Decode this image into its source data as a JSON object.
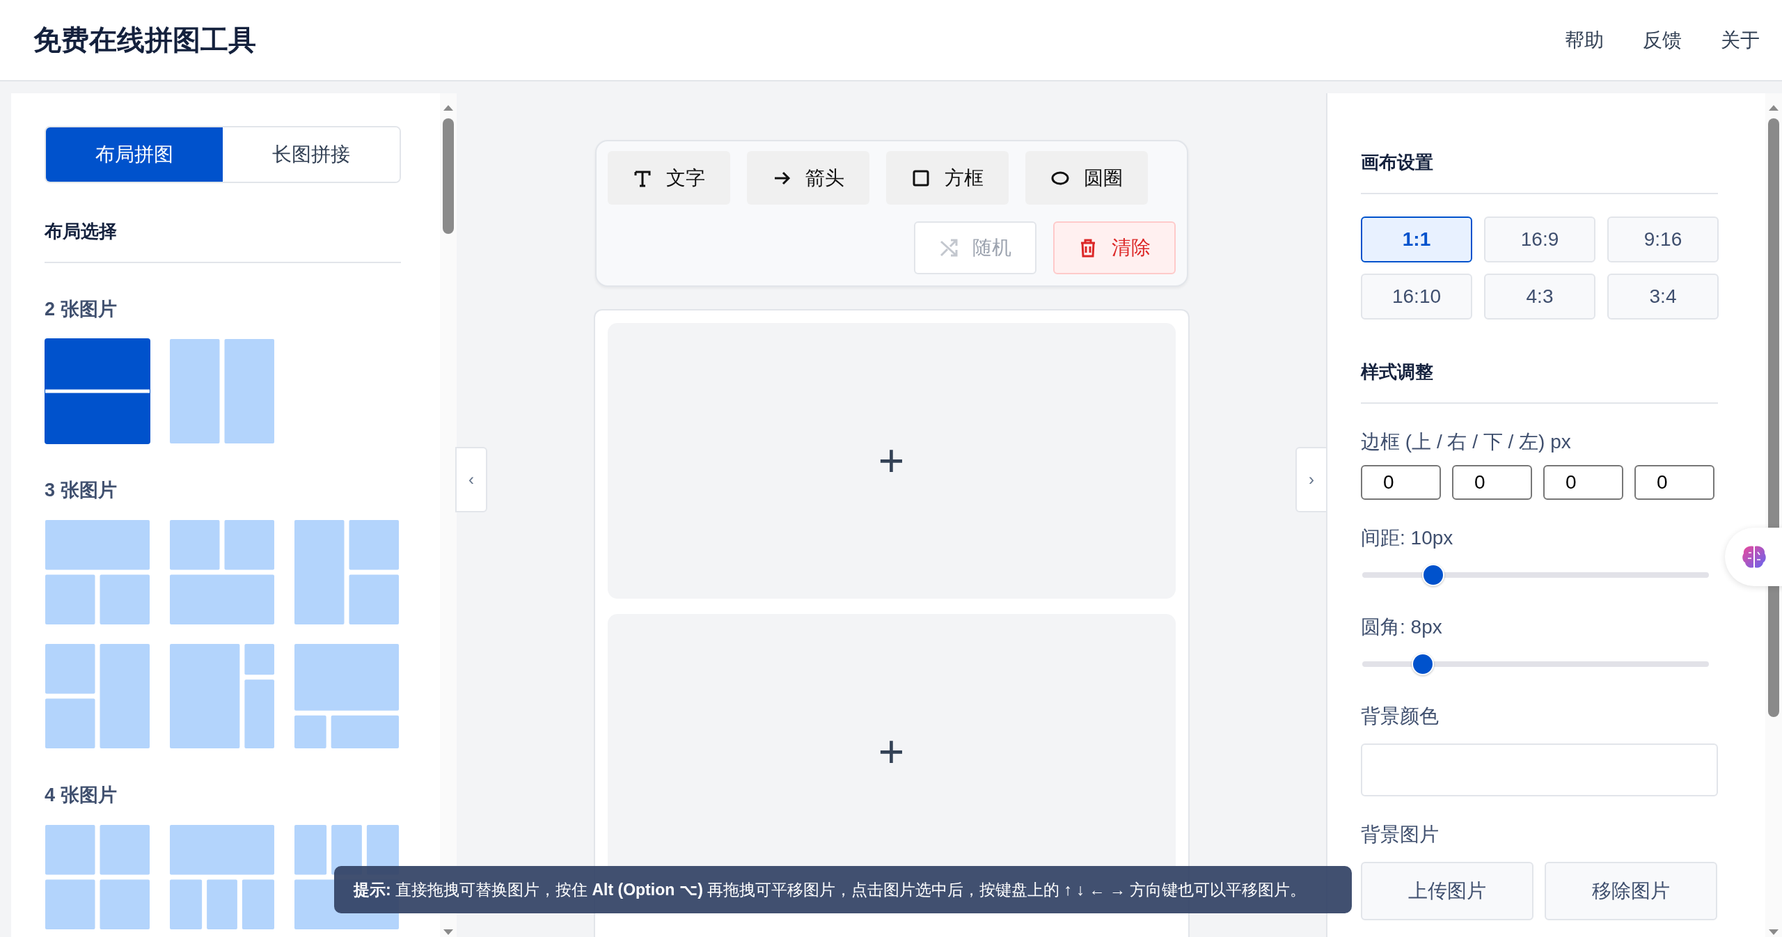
{
  "header": {
    "title": "免费在线拼图工具",
    "nav": [
      "帮助",
      "反馈",
      "关于"
    ]
  },
  "left_panel": {
    "tabs": [
      {
        "label": "布局拼图",
        "selected": true
      },
      {
        "label": "长图拼接",
        "selected": false
      }
    ],
    "section_title": "布局选择",
    "groups": [
      {
        "title": "2 张图片",
        "layouts": [
          {
            "kind": "h2",
            "selected": true
          },
          {
            "kind": "v2",
            "selected": false
          }
        ]
      },
      {
        "title": "3 张图片",
        "layouts": [
          {
            "kind": "t1b2",
            "selected": false
          },
          {
            "kind": "t2b1",
            "selected": false
          },
          {
            "kind": "l1r2",
            "selected": false
          },
          {
            "kind": "l2r1",
            "selected": false
          },
          {
            "kind": "bigleft",
            "selected": false
          },
          {
            "kind": "bigtop",
            "selected": false
          }
        ]
      },
      {
        "title": "4 张图片",
        "layouts": [
          {
            "kind": "g4",
            "selected": false
          },
          {
            "kind": "t1b3",
            "selected": false
          },
          {
            "kind": "t3b1",
            "selected": false
          }
        ]
      }
    ]
  },
  "collapse_handles": [
    "‹",
    "›"
  ],
  "toolbar": {
    "tools": [
      {
        "kind": "text",
        "label": "文字"
      },
      {
        "kind": "arrow",
        "label": "箭头"
      },
      {
        "kind": "rect",
        "label": "方框"
      },
      {
        "kind": "ellipse",
        "label": "圆圈"
      }
    ],
    "actions": [
      {
        "kind": "random",
        "label": "随机",
        "disabled": true
      },
      {
        "kind": "clear",
        "label": "清除",
        "disabled": false
      }
    ]
  },
  "canvas": {
    "cells": [
      {
        "label": "+"
      },
      {
        "label": "+"
      }
    ]
  },
  "right_panel": {
    "canvas_title": "画布设置",
    "ratios": [
      {
        "label": "1:1",
        "selected": true
      },
      {
        "label": "16:9",
        "selected": false
      },
      {
        "label": "9:16",
        "selected": false
      },
      {
        "label": "16:10",
        "selected": false
      },
      {
        "label": "4:3",
        "selected": false
      },
      {
        "label": "3:4",
        "selected": false
      }
    ],
    "style_title": "样式调整",
    "border_label": "边框 (上 / 右 / 下 / 左) px",
    "border_values": [
      "0",
      "0",
      "0",
      "0"
    ],
    "sliders": [
      {
        "label": "间距: 10px",
        "level": 0.2
      },
      {
        "label": "圆角: 8px",
        "level": 0.17
      }
    ],
    "bg_color_label": "背景颜色",
    "bg_image_label": "背景图片",
    "bg_image_buttons": [
      "上传图片",
      "移除图片"
    ]
  },
  "tip": "**提示:** 直接拖拽可替换图片，按住 **Alt (Option ⌥)** 再拖拽可平移图片，点击图片选中后，按键盘上的 ↑ ↓ ← → 方向键也可以平移图片。"
}
